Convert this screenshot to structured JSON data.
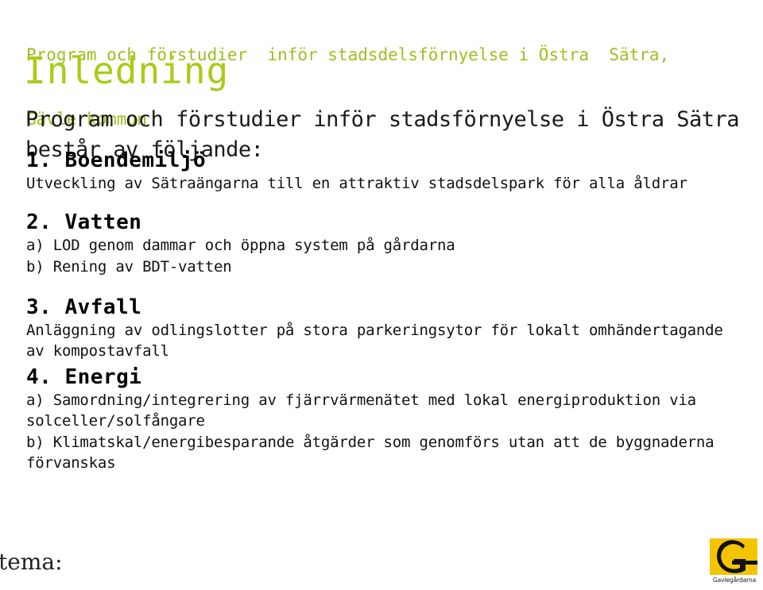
{
  "header": {
    "line1": "Program och förstudier  inför stadsdelsförnyelse i Östra  Sätra,",
    "line2": "Gävle kommun",
    "color": "#9cc01e"
  },
  "title": {
    "text": "Inledning",
    "color": "#a8cc18"
  },
  "intro": {
    "text": "Program och förstudier inför stadsförnyelse i Östra Sätra består av följande:"
  },
  "sections": [
    {
      "heading": "1. Boendemiljö",
      "body": "Utveckling av Sätraängarna till en attraktiv stadsdelspark för alla åldrar"
    },
    {
      "heading": "2. Vatten",
      "items": [
        "a) LOD genom dammar och öppna system på gårdarna",
        "b) Rening av BDT-vatten"
      ]
    },
    {
      "heading": "3. Avfall",
      "body": "Anläggning av odlingslotter på stora parkeringsytor för lokalt omhändertagande av kompostavfall"
    },
    {
      "heading": "4. Energi",
      "items": [
        "a) Samordning/integrering av fjärrvärmenätet med lokal energiproduktion via solceller/solfångare",
        "b) Klimatskal/energibesparande åtgärder som genomförs utan att de byggnaderna förvanskas"
      ]
    }
  ],
  "footer": {
    "tema_label": "tema:",
    "logo": {
      "caption": "Gavlegårdarna",
      "letter": "G",
      "background_color": "#f5c400",
      "mark_color": "#111111",
      "icon_name": "gavlegardarna-logo-icon"
    }
  }
}
